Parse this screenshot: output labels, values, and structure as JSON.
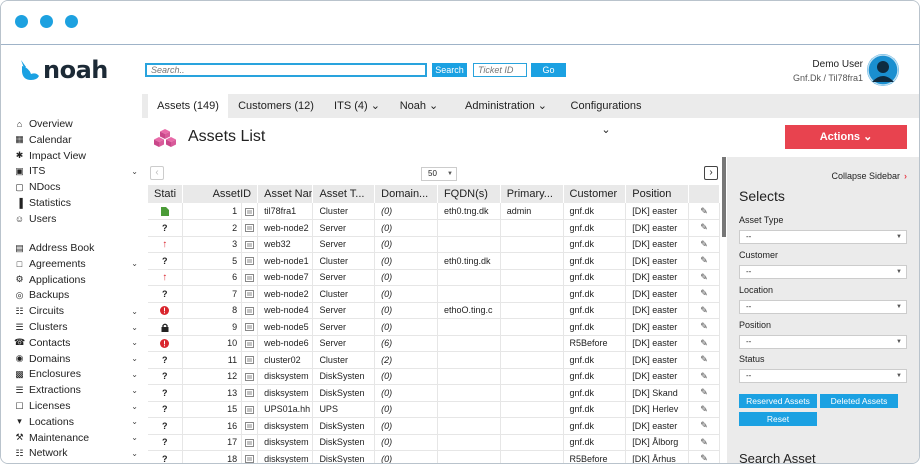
{
  "titlebar": {
    "dots": [
      "dot1",
      "dot2",
      "dot3"
    ],
    "color": "#1da1e0"
  },
  "header": {
    "logo_text": "noah",
    "search_placeholder": "Search..",
    "search_button": "Search",
    "ticket_placeholder": "Ticket ID",
    "go_button": "Go",
    "user_name": "Demo User",
    "user_sub": "Gnf.Dk  /  Til78fra1"
  },
  "tabs": [
    {
      "label": "Assets (149)",
      "active": true
    },
    {
      "label": "Customers (12)",
      "active": false
    },
    {
      "label": "ITS (4) ⌄",
      "active": false
    },
    {
      "label": "Noah ⌄",
      "active": false
    },
    {
      "label": "Administration ⌄",
      "active": false
    },
    {
      "label": "Configurations ⌄",
      "active": false
    }
  ],
  "sidebar": {
    "group1": [
      {
        "label": "Overview",
        "icon": "home-icon",
        "chev": false
      },
      {
        "label": "Calendar",
        "icon": "calendar-icon",
        "chev": false
      },
      {
        "label": "Impact View",
        "icon": "asterisk-icon",
        "chev": false
      },
      {
        "label": "ITS",
        "icon": "ticket-icon",
        "chev": true
      },
      {
        "label": "NDocs",
        "icon": "document-icon",
        "chev": false
      },
      {
        "label": "Statistics",
        "icon": "bar-chart-icon",
        "chev": false
      },
      {
        "label": "Users",
        "icon": "users-icon",
        "chev": false
      }
    ],
    "group2": [
      {
        "label": "Address Book",
        "icon": "book-icon",
        "chev": false
      },
      {
        "label": "Agreements",
        "icon": "file-icon",
        "chev": true
      },
      {
        "label": "Applications",
        "icon": "gear-icon",
        "chev": false
      },
      {
        "label": "Backups",
        "icon": "backup-icon",
        "chev": false
      },
      {
        "label": "Circuits",
        "icon": "circuit-icon",
        "chev": true
      },
      {
        "label": "Clusters",
        "icon": "cluster-icon",
        "chev": true
      },
      {
        "label": "Contacts",
        "icon": "phone-icon",
        "chev": true
      },
      {
        "label": "Domains",
        "icon": "globe-icon",
        "chev": true
      },
      {
        "label": "Enclosures",
        "icon": "enclosure-icon",
        "chev": true
      },
      {
        "label": "Extractions",
        "icon": "extraction-icon",
        "chev": true
      },
      {
        "label": "Licenses",
        "icon": "license-icon",
        "chev": true
      },
      {
        "label": "Locations",
        "icon": "location-pin-icon",
        "chev": true
      },
      {
        "label": "Maintenance",
        "icon": "maintenance-icon",
        "chev": true
      },
      {
        "label": "Network",
        "icon": "network-icon",
        "chev": true
      }
    ]
  },
  "main": {
    "title": "Assets List",
    "actions_label": "Actions ⌄",
    "page_size": "50",
    "columns": [
      "Stati",
      "AssetID",
      "Asset Nam",
      "Asset T...",
      "Domain...",
      "FQDN(s)",
      "Primary...",
      "Customer",
      "Position"
    ],
    "rows": [
      {
        "status": "ok",
        "id": "1",
        "name": "til78fra1",
        "type": "Cluster",
        "domain": "(0)",
        "fqdn": "eth0.tng.dk",
        "primary": "admin",
        "customer": "gnf.dk",
        "position": "[DK] easter"
      },
      {
        "status": "unknown",
        "id": "2",
        "name": "web-node2",
        "type": "Server",
        "domain": "(0)",
        "fqdn": "",
        "primary": "",
        "customer": "gnf.dk",
        "position": "[DK] easter"
      },
      {
        "status": "up",
        "id": "3",
        "name": "web32",
        "type": "Server",
        "domain": "(0)",
        "fqdn": "",
        "primary": "",
        "customer": "gnf.dk",
        "position": "[DK] easter"
      },
      {
        "status": "unknown",
        "id": "5",
        "name": "web-node1",
        "type": "Cluster",
        "domain": "(0)",
        "fqdn": "eth0.ting.dk",
        "primary": "",
        "customer": "gnf.dk",
        "position": "[DK] easter"
      },
      {
        "status": "up",
        "id": "6",
        "name": "web-node7",
        "type": "Server",
        "domain": "(0)",
        "fqdn": "",
        "primary": "",
        "customer": "gnf.dk",
        "position": "[DK] easter"
      },
      {
        "status": "unknown",
        "id": "7",
        "name": "web-node2",
        "type": "Cluster",
        "domain": "(0)",
        "fqdn": "",
        "primary": "",
        "customer": "gnf.dk",
        "position": "[DK] easter"
      },
      {
        "status": "alert",
        "id": "8",
        "name": "web-node4",
        "type": "Server",
        "domain": "(0)",
        "fqdn": "ethoO.ting.c",
        "primary": "",
        "customer": "gnf.dk",
        "position": "[DK] easter"
      },
      {
        "status": "lock",
        "id": "9",
        "name": "web-node5",
        "type": "Server",
        "domain": "(0)",
        "fqdn": "",
        "primary": "",
        "customer": "gnf.dk",
        "position": "[DK] easter"
      },
      {
        "status": "alert",
        "id": "10",
        "name": "web-node6",
        "type": "Server",
        "domain": "(6)",
        "fqdn": "",
        "primary": "",
        "customer": "R5Before",
        "position": "[DK] easter"
      },
      {
        "status": "unknown",
        "id": "11",
        "name": "cluster02",
        "type": "Cluster",
        "domain": "(2)",
        "fqdn": "",
        "primary": "",
        "customer": "gnf.dk",
        "position": "[DK] easter"
      },
      {
        "status": "unknown",
        "id": "12",
        "name": "disksystem",
        "type": "DiskSysten",
        "domain": "(0)",
        "fqdn": "",
        "primary": "",
        "customer": "gnf.dk",
        "position": "[DK] easter"
      },
      {
        "status": "unknown",
        "id": "13",
        "name": "disksystem",
        "type": "DiskSysten",
        "domain": "(0)",
        "fqdn": "",
        "primary": "",
        "customer": "gnf.dk",
        "position": "[DK] Skand"
      },
      {
        "status": "unknown",
        "id": "15",
        "name": "UPS01a.hh",
        "type": "UPS",
        "domain": "(0)",
        "fqdn": "",
        "primary": "",
        "customer": "gnf.dk",
        "position": "[DK] Herlev"
      },
      {
        "status": "unknown",
        "id": "16",
        "name": "disksystem",
        "type": "DiskSysten",
        "domain": "(0)",
        "fqdn": "",
        "primary": "",
        "customer": "gnf.dk",
        "position": "[DK] easter"
      },
      {
        "status": "unknown",
        "id": "17",
        "name": "disksystem",
        "type": "DiskSysten",
        "domain": "(0)",
        "fqdn": "",
        "primary": "",
        "customer": "gnf.dk",
        "position": "[DK] Ålborg"
      },
      {
        "status": "unknown",
        "id": "18",
        "name": "disksystem",
        "type": "DiskSysten",
        "domain": "(0)",
        "fqdn": "",
        "primary": "",
        "customer": "R5Before",
        "position": "[DK] Århus"
      }
    ]
  },
  "right": {
    "collapse_label": "Collapse Sidebar",
    "selects_title": "Selects",
    "fields": [
      {
        "label": "Asset Type",
        "value": "--"
      },
      {
        "label": "Customer",
        "value": "--"
      },
      {
        "label": "Location",
        "value": "--"
      },
      {
        "label": "Position",
        "value": "--"
      },
      {
        "label": "Status",
        "value": "--"
      }
    ],
    "reserved_button": "Reserved Assets",
    "deleted_button": "Deleted Assets",
    "reset_button": "Reset",
    "search_asset_title": "Search Asset"
  },
  "colors": {
    "accent": "#1ba1e2",
    "actions": "#e8434f",
    "status_ok": "#4a9b37",
    "status_alert": "#d9262e"
  }
}
